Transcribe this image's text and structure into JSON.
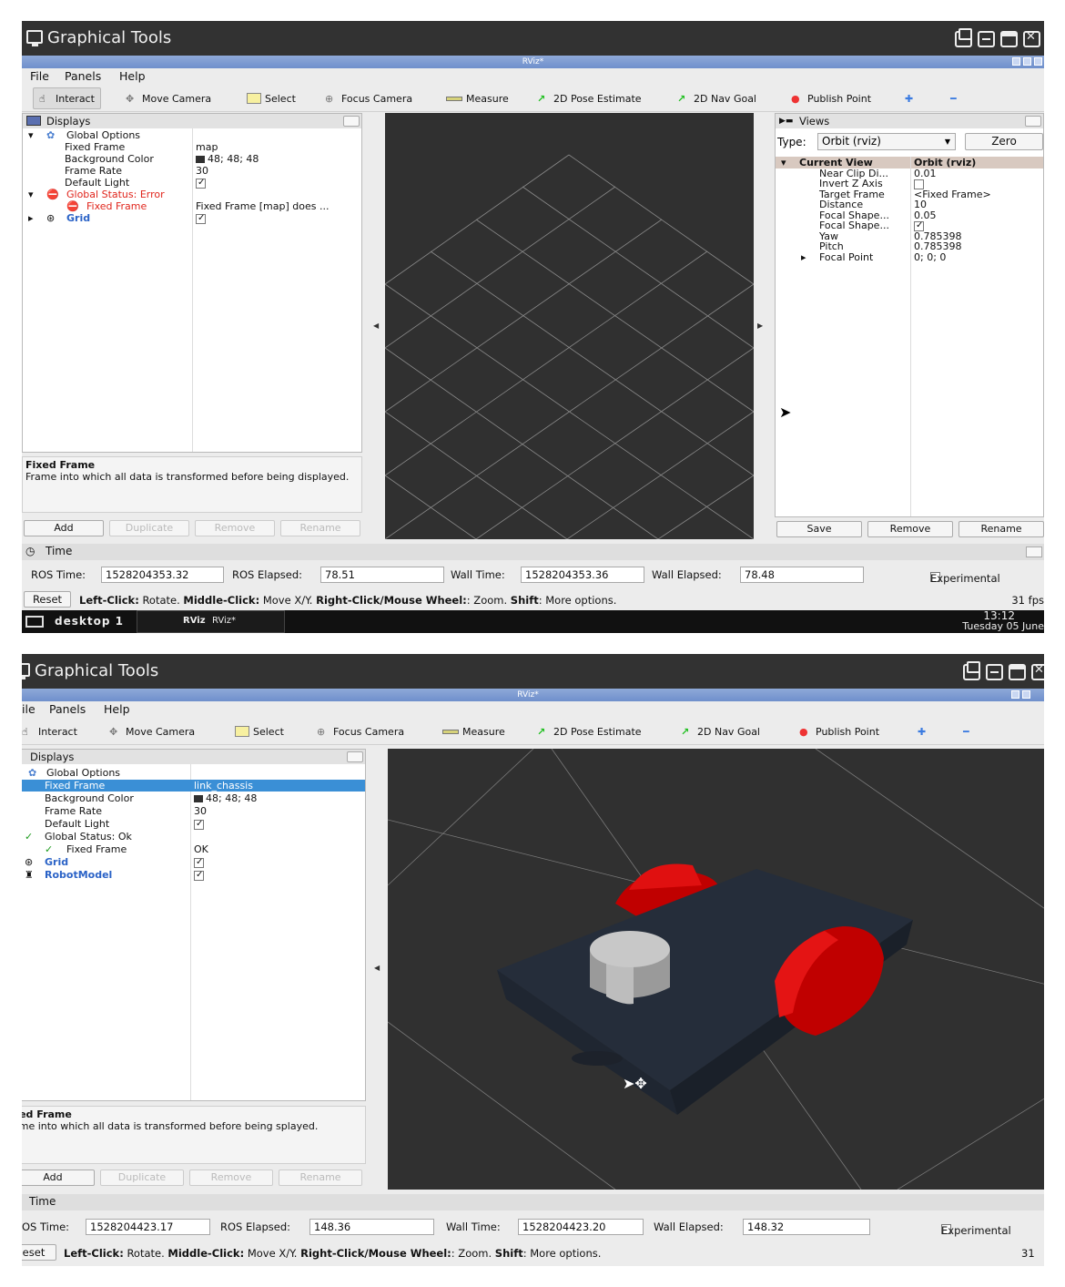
{
  "title": "Graphical Tools",
  "rviz_title": "RViz*",
  "menu": [
    "File",
    "Panels",
    "Help"
  ],
  "menu_w2": [
    "ile",
    "Panels",
    "Help"
  ],
  "tools": {
    "interact": "Interact",
    "move_camera": "Move Camera",
    "select": "Select",
    "focus_camera": "Focus Camera",
    "measure": "Measure",
    "pose": "2D Pose Estimate",
    "nav": "2D Nav Goal",
    "publish": "Publish Point",
    "plus": "✚",
    "minus": "━"
  },
  "displays": {
    "title": "Displays"
  },
  "w1": {
    "tree": {
      "global": "Global Options",
      "fixed_frame": "Fixed Frame",
      "fixed_frame_val": "map",
      "bg": "Background Color",
      "bg_val": "48; 48; 48",
      "fr": "Frame Rate",
      "fr_val": "30",
      "dl": "Default Light",
      "status": "Global Status: Error",
      "ff_err": "Fixed Frame",
      "ff_err_val": "Fixed Frame [map] does ...",
      "grid": "Grid"
    },
    "desc_title": "Fixed Frame",
    "desc_text": "Frame into which all data is transformed before being displayed.",
    "btns": {
      "add": "Add",
      "dup": "Duplicate",
      "rem": "Remove",
      "ren": "Rename"
    },
    "views": {
      "title": "Views",
      "type_label": "Type:",
      "type_val": "Orbit (rviz)",
      "zero": "Zero",
      "current": "Current View",
      "current_val": "Orbit (rviz)",
      "rows": [
        {
          "k": "Near Clip Di...",
          "v": "0.01"
        },
        {
          "k": "Invert Z Axis",
          "v": ""
        },
        {
          "k": "Target Frame",
          "v": "<Fixed Frame>"
        },
        {
          "k": "Distance",
          "v": "10"
        },
        {
          "k": "Focal Shape...",
          "v": "0.05"
        },
        {
          "k": "Focal Shape...",
          "v": ""
        },
        {
          "k": "Yaw",
          "v": "0.785398"
        },
        {
          "k": "Pitch",
          "v": "0.785398"
        },
        {
          "k": "Focal Point",
          "v": "0; 0; 0"
        }
      ],
      "save": "Save",
      "remove": "Remove",
      "rename": "Rename"
    },
    "time": {
      "label": "Time",
      "ros_time_l": "ROS Time:",
      "ros_time": "1528204353.32",
      "ros_el_l": "ROS Elapsed:",
      "ros_el": "78.51",
      "wall_time_l": "Wall Time:",
      "wall_time": "1528204353.36",
      "wall_el_l": "Wall Elapsed:",
      "wall_el": "78.48",
      "exp": "Experimental"
    },
    "status": {
      "reset": "Reset",
      "lc": "Left-Click:",
      "lc_t": " Rotate. ",
      "mc": "Middle-Click:",
      "mc_t": " Move X/Y. ",
      "rc": "Right-Click/Mouse Wheel:",
      "rc_t": ": Zoom. ",
      "sh": "Shift",
      "sh_t": ": More options.",
      "fps": "31 fps"
    },
    "taskbar": {
      "desktop": "desktop 1",
      "rviz_icon": "RViz",
      "rviz": "RViz*",
      "clock": "13:12",
      "date": "Tuesday 05 June"
    }
  },
  "w2": {
    "tree": {
      "global": "Global Options",
      "fixed_frame": "Fixed Frame",
      "fixed_frame_val": "link_chassis",
      "bg": "Background Color",
      "bg_val": "48; 48; 48",
      "fr": "Frame Rate",
      "fr_val": "30",
      "dl": "Default Light",
      "status": "Global Status: Ok",
      "ff_ok": "Fixed Frame",
      "ff_ok_val": "OK",
      "grid": "Grid",
      "robot": "RobotModel"
    },
    "desc_title": "xed Frame",
    "desc_text": "ame into which all data is transformed before being splayed.",
    "btns": {
      "add": "Add",
      "dup": "Duplicate",
      "rem": "Remove",
      "ren": "Rename"
    },
    "time": {
      "label": "Time",
      "ros_time_l": "OS Time:",
      "ros_time": "1528204423.17",
      "ros_el_l": "ROS Elapsed:",
      "ros_el": "148.36",
      "wall_time_l": "Wall Time:",
      "wall_time": "1528204423.20",
      "wall_el_l": "Wall Elapsed:",
      "wall_el": "148.32",
      "exp": "Experimental"
    },
    "status": {
      "reset": "eset",
      "lc": "Left-Click:",
      "lc_t": " Rotate. ",
      "mc": "Middle-Click:",
      "mc_t": " Move X/Y. ",
      "rc": "Right-Click/Mouse Wheel:",
      "rc_t": ": Zoom. ",
      "sh": "Shift",
      "sh_t": ": More options.",
      "fps": "31"
    }
  },
  "colors": {
    "bg3d": "#303030",
    "wheel": "#d40000",
    "chassis": "#232a35",
    "error": "#e0241b",
    "selected": "#3a8fd6"
  }
}
